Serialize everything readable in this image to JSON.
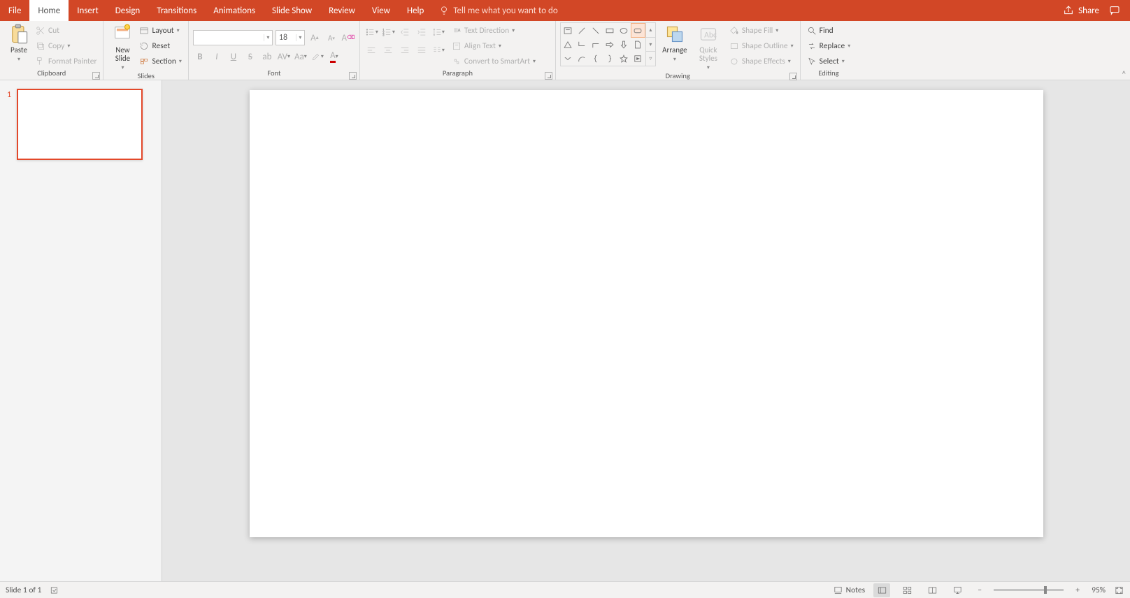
{
  "tabs": {
    "file": "File",
    "home": "Home",
    "insert": "Insert",
    "design": "Design",
    "transitions": "Transitions",
    "animations": "Animations",
    "slideshow": "Slide Show",
    "review": "Review",
    "view": "View",
    "help": "Help",
    "tellme": "Tell me what you want to do",
    "share": "Share"
  },
  "ribbon": {
    "clipboard": {
      "label": "Clipboard",
      "paste": "Paste",
      "cut": "Cut",
      "copy": "Copy",
      "format_painter": "Format Painter"
    },
    "slides": {
      "label": "Slides",
      "new_slide": "New\nSlide",
      "layout": "Layout",
      "reset": "Reset",
      "section": "Section"
    },
    "font": {
      "label": "Font",
      "name": "",
      "size": "18"
    },
    "paragraph": {
      "label": "Paragraph",
      "text_direction": "Text Direction",
      "align_text": "Align Text",
      "convert_smartart": "Convert to SmartArt"
    },
    "drawing": {
      "label": "Drawing",
      "arrange": "Arrange",
      "quick_styles": "Quick\nStyles",
      "shape_fill": "Shape Fill",
      "shape_outline": "Shape Outline",
      "shape_effects": "Shape Effects"
    },
    "editing": {
      "label": "Editing",
      "find": "Find",
      "replace": "Replace",
      "select": "Select"
    }
  },
  "thumbs": {
    "n1": "1"
  },
  "status": {
    "slide_of": "Slide 1 of 1",
    "notes": "Notes",
    "zoom": "95%"
  }
}
